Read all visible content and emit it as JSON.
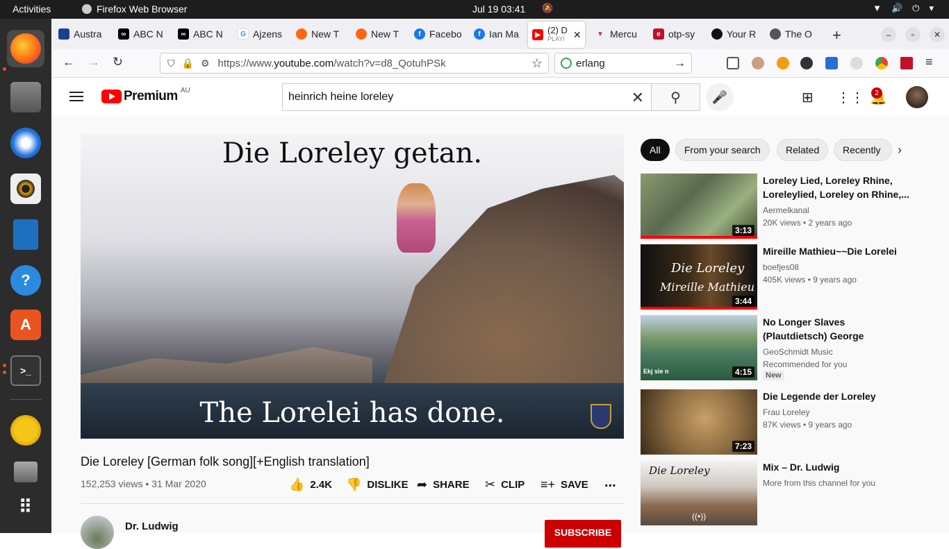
{
  "topbar": {
    "activities": "Activities",
    "app_name": "Firefox Web Browser",
    "clock": "Jul 19  03:41"
  },
  "dock": {
    "apps": [
      "firefox",
      "files",
      "thunderbird",
      "rhythmbox",
      "libreoffice-writer",
      "help",
      "app-center",
      "terminal",
      "teapot",
      "storage",
      "show-apps"
    ]
  },
  "tabs": [
    {
      "label": "Austra",
      "icon": "australia-flag-icon"
    },
    {
      "label": "ABC N",
      "icon": "abc-icon"
    },
    {
      "label": "ABC N",
      "icon": "abc-icon"
    },
    {
      "label": "Ajzens",
      "icon": "google-icon"
    },
    {
      "label": "New T",
      "icon": "firefox-icon"
    },
    {
      "label": "New T",
      "icon": "firefox-icon"
    },
    {
      "label": "Facebo",
      "icon": "facebook-icon"
    },
    {
      "label": "Ian Ma",
      "icon": "facebook-icon"
    },
    {
      "label": "(2) D",
      "sub": "PLAYI",
      "icon": "youtube-icon",
      "active": true
    },
    {
      "label": "Mercu",
      "icon": "mercury-icon"
    },
    {
      "label": "otp-sy",
      "icon": "otp-icon"
    },
    {
      "label": "Your R",
      "icon": "github-icon"
    },
    {
      "label": "The O",
      "icon": "tab-icon"
    }
  ],
  "navbar": {
    "url_prefix": "https://www.",
    "url_domain": "youtube.com",
    "url_path": "/watch?v=d8_QotuhPSk",
    "search_value": "erlang"
  },
  "youtube": {
    "logo_text": "Premium",
    "region": "AU",
    "search_value": "heinrich heine loreley",
    "notification_count": "2",
    "video": {
      "subtitle_top": "Die Loreley getan.",
      "subtitle_bottom": "The Lorelei has done.",
      "title": "Die Loreley [German folk song][+English translation]",
      "meta": "152,253 views • 31 Mar 2020",
      "likes": "2.4K",
      "dislike": "DISLIKE",
      "share": "SHARE",
      "clip": "CLIP",
      "save": "SAVE",
      "more": "...",
      "channel": "Dr. Ludwig",
      "subscribe": "SUBSCRIBE"
    },
    "chips": [
      "All",
      "From your search",
      "Related",
      "Recently"
    ],
    "recommendations": [
      {
        "title": "Loreley Lied, Loreley Rhine, Loreleylied, Loreley on Rhine,...",
        "channel": "Aermelkanal",
        "meta": "20K views • 2 years ago",
        "duration": "3:13",
        "progress": 1.0
      },
      {
        "title": "Mireille Mathieu~~Die Lorelei",
        "channel": "boefjes08",
        "meta": "405K views • 9 years ago",
        "duration": "3:44",
        "progress": 1.0,
        "thumb_text1": "Die Loreley",
        "thumb_text2": "Mireille Mathieu"
      },
      {
        "title": "No Longer Slaves (Plautdietsch) George Schmidt/John Thiessen",
        "channel": "GeoSchmidt Music",
        "meta": "Recommended for you",
        "badge": "New",
        "duration": "4:15",
        "thumb_text1": "Ekj sie n"
      },
      {
        "title": "Die Legende der Loreley",
        "channel": "Frau Loreley",
        "meta": "87K views • 9 years ago",
        "duration": "7:23"
      },
      {
        "title": "Mix – Dr. Ludwig",
        "channel": "More from this channel for you",
        "thumb_text1": "Die Loreley"
      }
    ]
  }
}
